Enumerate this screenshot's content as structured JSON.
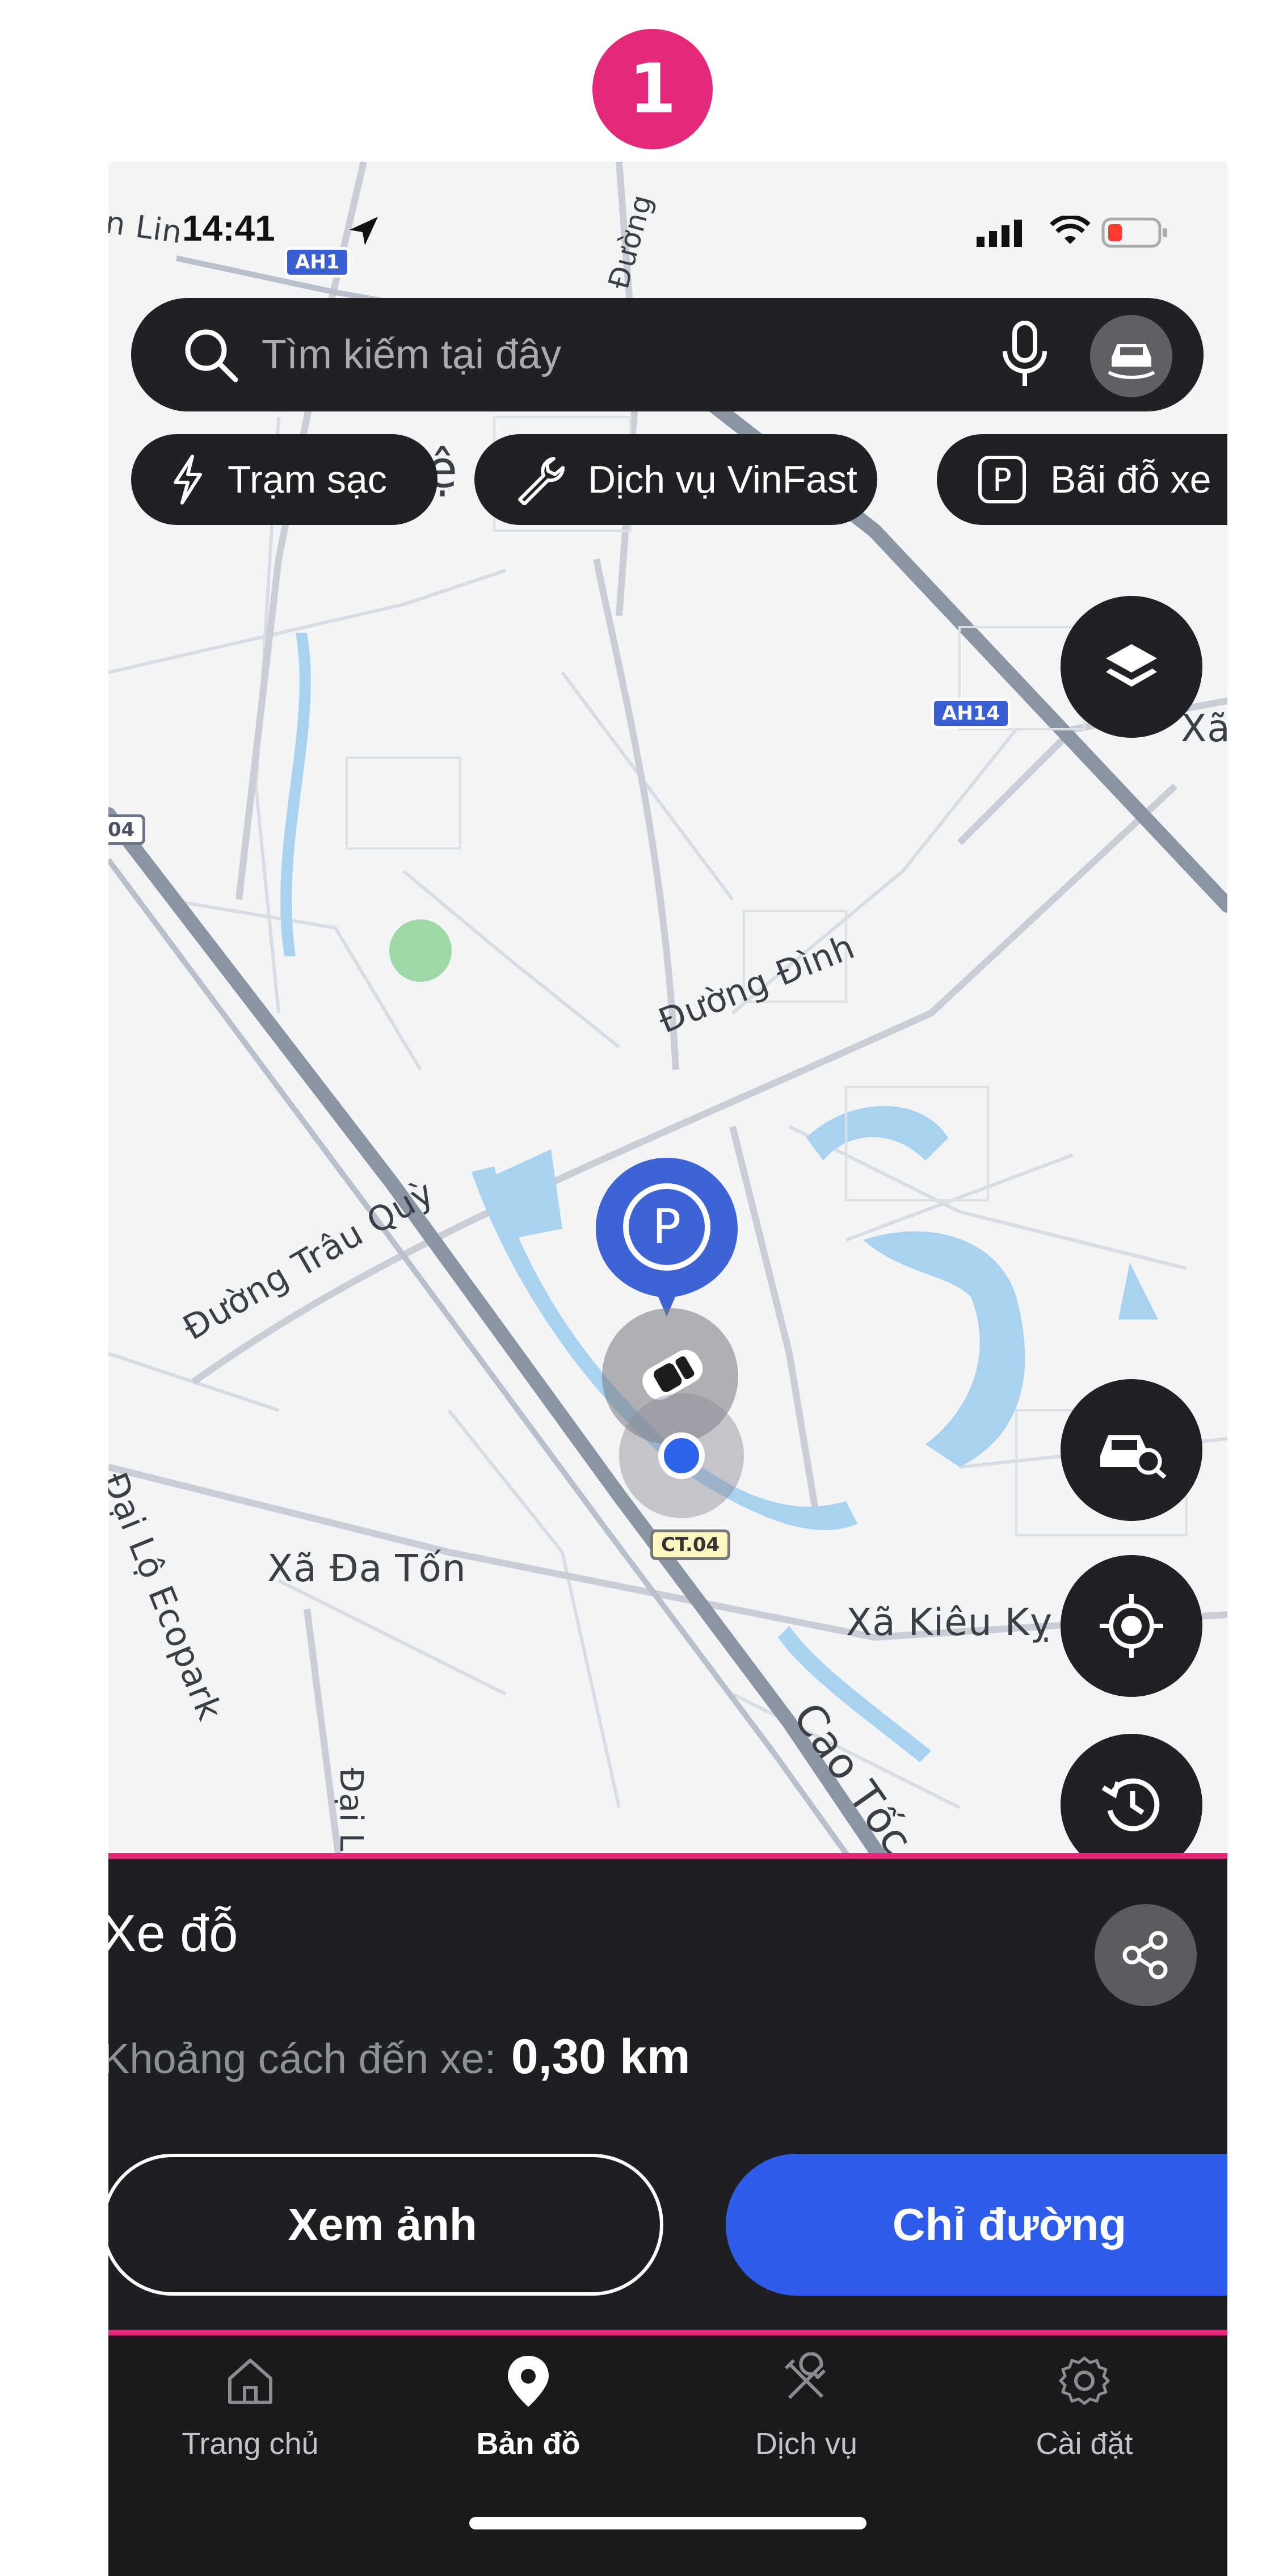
{
  "step_badge": "1",
  "status_bar": {
    "time": "14:41"
  },
  "search": {
    "placeholder": "Tìm kiếm tại đây"
  },
  "chips": [
    {
      "label": "Trạm sạc",
      "icon": "lightning-icon"
    },
    {
      "label": "Dịch vụ VinFast",
      "icon": "wrench-icon"
    },
    {
      "label": "Bãi đỗ xe",
      "icon": "parking-icon"
    }
  ],
  "map": {
    "labels": {
      "duong_dinh": "Đường Đình",
      "duong_trau_quy": "Đường Trâu Quỳ",
      "xa_da_ton": "Xã Đa Tốn",
      "xa_kieu_ky": "Xã Kiêu Kỵ",
      "dai_lo_ecopark": "Đại Lộ Ecopark",
      "cao_toc": "Cao Tốc",
      "xa_right": "Xã",
      "duong_top": "Đường",
      "dai_lo_short": "Đại Lộ",
      "linh_top": "n Lin",
      "e_fragment": "ệ"
    },
    "shields": {
      "ah1": "AH1",
      "ah14": "AH14",
      "ct04": "CT.04",
      "route04": "04"
    }
  },
  "panel": {
    "title": "Xe đỗ",
    "distance_label": "Khoảng cách đến xe:",
    "distance_value": "0,30 km",
    "view_photo_label": "Xem ảnh",
    "directions_label": "Chỉ đường"
  },
  "tabs": [
    {
      "label": "Trang chủ",
      "icon": "home-icon",
      "active": false
    },
    {
      "label": "Bản đồ",
      "icon": "map-pin-icon",
      "active": true
    },
    {
      "label": "Dịch vụ",
      "icon": "tools-icon",
      "active": false
    },
    {
      "label": "Cài đặt",
      "icon": "settings-icon",
      "active": false
    }
  ],
  "colors": {
    "accent_pink": "#e6287a",
    "primary_blue": "#2d5bea",
    "dark_surface": "#202124",
    "map_bg": "#f2f4f6",
    "water": "#a8d2f0"
  }
}
